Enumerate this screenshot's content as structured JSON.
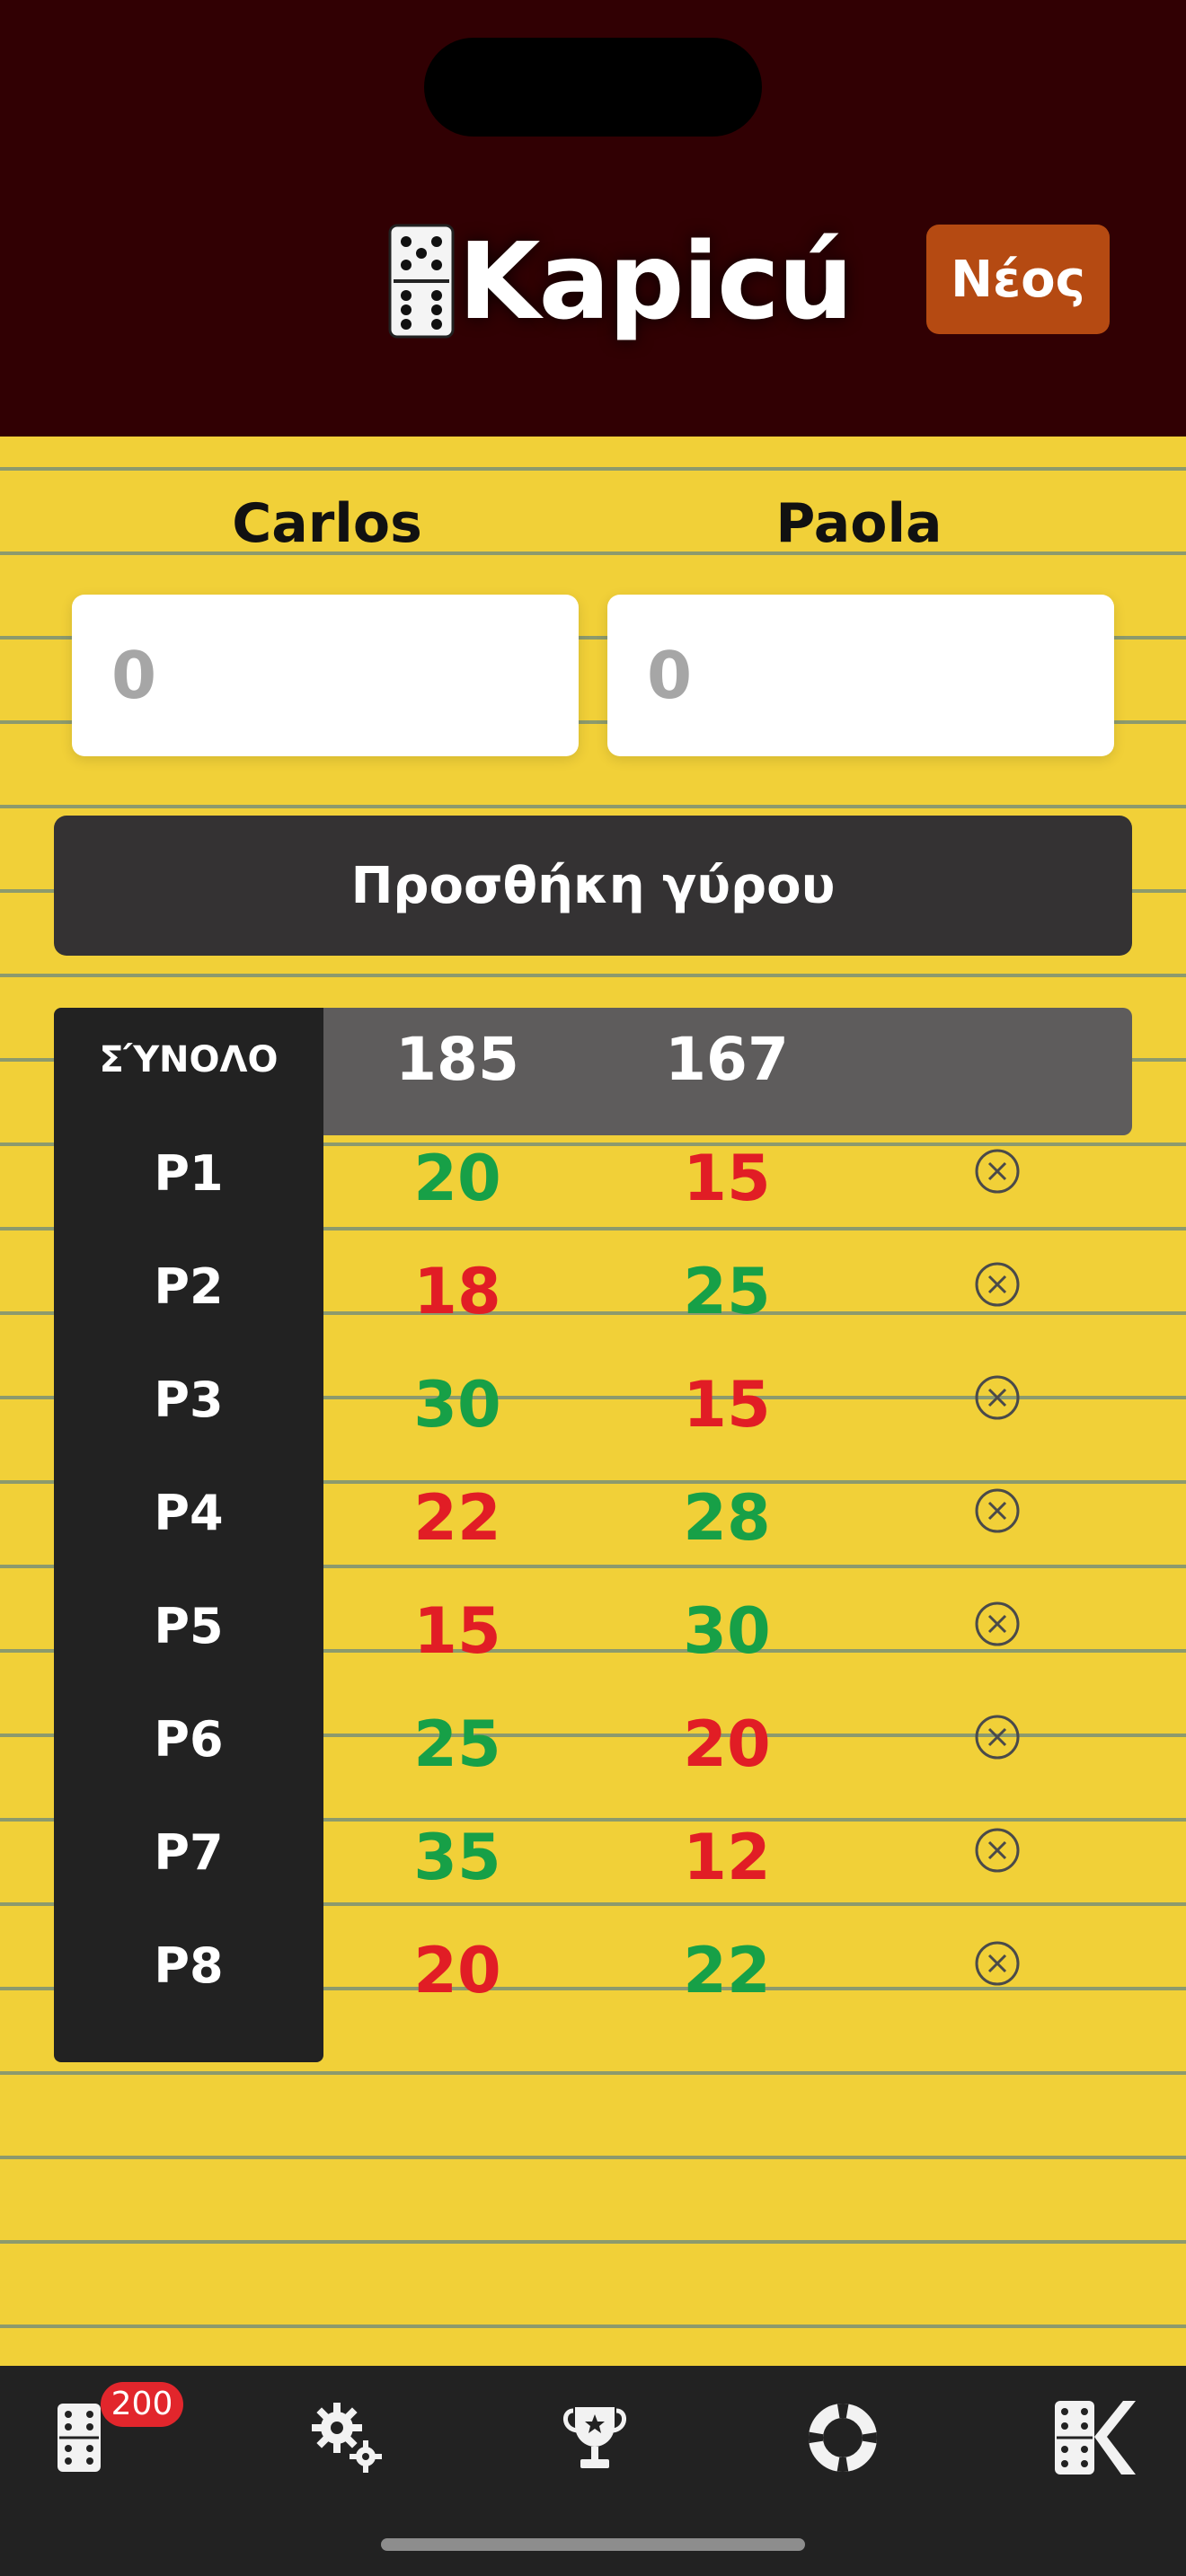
{
  "header": {
    "logo_text": "Kapicú",
    "new_button": "Νέος"
  },
  "players": [
    {
      "name": "Carlos",
      "input_placeholder": "0"
    },
    {
      "name": "Paola",
      "input_placeholder": "0"
    }
  ],
  "add_round_label": "Προσθήκη γύρου",
  "totals": {
    "label": "ΣΎΝΟΛΟ",
    "values": [
      "185",
      "167"
    ]
  },
  "rounds": [
    {
      "label": "P1",
      "values": [
        "20",
        "15"
      ],
      "winner": 0
    },
    {
      "label": "P2",
      "values": [
        "18",
        "25"
      ],
      "winner": 1
    },
    {
      "label": "P3",
      "values": [
        "30",
        "15"
      ],
      "winner": 0
    },
    {
      "label": "P4",
      "values": [
        "22",
        "28"
      ],
      "winner": 1
    },
    {
      "label": "P5",
      "values": [
        "15",
        "30"
      ],
      "winner": 1
    },
    {
      "label": "P6",
      "values": [
        "25",
        "20"
      ],
      "winner": 0
    },
    {
      "label": "P7",
      "values": [
        "35",
        "12"
      ],
      "winner": 0
    },
    {
      "label": "P8",
      "values": [
        "20",
        "22"
      ],
      "winner": 1
    }
  ],
  "tabbar": {
    "items": [
      {
        "icon": "domino-icon",
        "badge": "200"
      },
      {
        "icon": "settings-gears-icon"
      },
      {
        "icon": "trophy-icon"
      },
      {
        "icon": "lifebuoy-icon"
      },
      {
        "icon": "kapicu-logo-icon"
      }
    ]
  },
  "colors": {
    "header_bg": "#310003",
    "paper": "#f1d038",
    "new_button": "#b54a12",
    "win": "#17a047",
    "lose": "#e11d25",
    "dark": "#222222"
  }
}
